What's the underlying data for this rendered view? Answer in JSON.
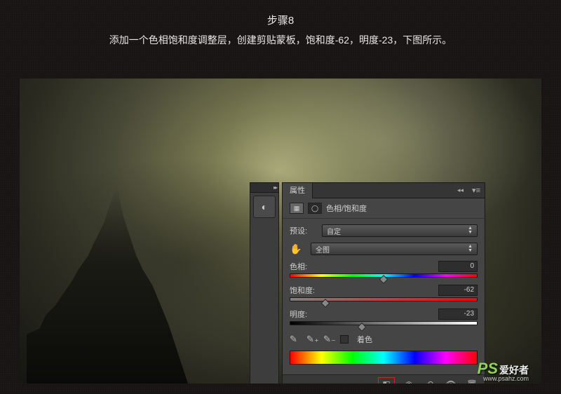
{
  "header": {
    "title": "步骤8",
    "description": "添加一个色相饱和度调整层，创建剪贴蒙板，饱和度-62，明度-23，下图所示。"
  },
  "panel": {
    "tab_label": "属性",
    "adjustment_label": "色相/饱和度",
    "preset": {
      "label": "预设:",
      "value": "自定"
    },
    "scope": {
      "value": "全图"
    },
    "hue": {
      "label": "色相:",
      "value": "0",
      "position": 50
    },
    "saturation": {
      "label": "饱和度:",
      "value": "-62",
      "position": 19
    },
    "lightness": {
      "label": "明度:",
      "value": "-23",
      "position": 38.5
    },
    "colorize": {
      "label": "着色"
    }
  },
  "watermark": {
    "logo": "PS",
    "text": "爱好者",
    "url": "www.psahz.com"
  }
}
